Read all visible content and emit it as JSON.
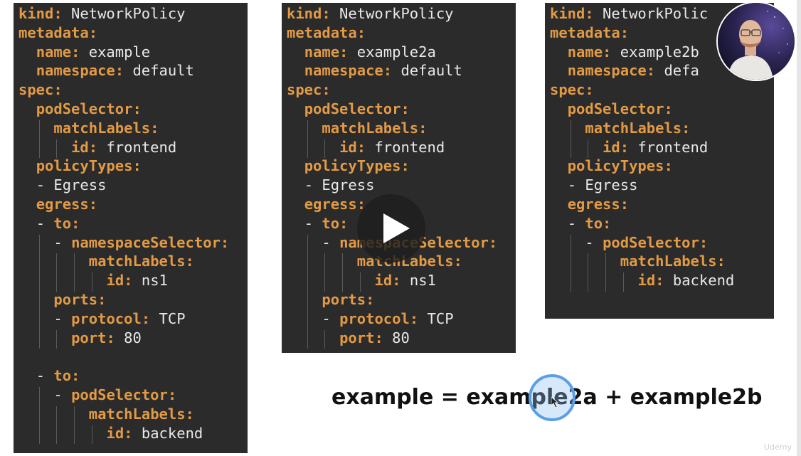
{
  "panels": [
    {
      "id": "panel-1",
      "lines": [
        {
          "indent": 0,
          "key": "kind:",
          "value": " NetworkPolicy"
        },
        {
          "indent": 0,
          "key": "metadata:",
          "value": ""
        },
        {
          "indent": 1,
          "key": "name:",
          "value": " example"
        },
        {
          "indent": 1,
          "key": "namespace:",
          "value": " default"
        },
        {
          "indent": 0,
          "key": "spec:",
          "value": ""
        },
        {
          "indent": 1,
          "key": "podSelector:",
          "value": ""
        },
        {
          "indent": 2,
          "key": "matchLabels:",
          "value": ""
        },
        {
          "indent": 3,
          "key": "id:",
          "value": " frontend"
        },
        {
          "indent": 1,
          "key": "policyTypes:",
          "value": ""
        },
        {
          "indent": 1,
          "key": "",
          "value": "- Egress"
        },
        {
          "indent": 1,
          "key": "egress:",
          "value": ""
        },
        {
          "indent": 1,
          "dash": true,
          "key": "to:",
          "value": ""
        },
        {
          "indent": 2,
          "dash": true,
          "key": "namespaceSelector:",
          "value": ""
        },
        {
          "indent": 4,
          "key": "matchLabels:",
          "value": ""
        },
        {
          "indent": 5,
          "key": "id:",
          "value": " ns1"
        },
        {
          "indent": 2,
          "key": "ports:",
          "value": ""
        },
        {
          "indent": 2,
          "dash": true,
          "key": "protocol:",
          "value": " TCP"
        },
        {
          "indent": 3,
          "key": "port:",
          "value": " 80"
        },
        {
          "indent": 0,
          "key": "",
          "value": ""
        },
        {
          "indent": 1,
          "dash": true,
          "key": "to:",
          "value": ""
        },
        {
          "indent": 2,
          "dash": true,
          "key": "podSelector:",
          "value": ""
        },
        {
          "indent": 4,
          "key": "matchLabels:",
          "value": ""
        },
        {
          "indent": 5,
          "key": "id:",
          "value": " backend"
        }
      ]
    },
    {
      "id": "panel-2",
      "lines": [
        {
          "indent": 0,
          "key": "kind:",
          "value": " NetworkPolicy"
        },
        {
          "indent": 0,
          "key": "metadata:",
          "value": ""
        },
        {
          "indent": 1,
          "key": "name:",
          "value": " example2a"
        },
        {
          "indent": 1,
          "key": "namespace:",
          "value": " default"
        },
        {
          "indent": 0,
          "key": "spec:",
          "value": ""
        },
        {
          "indent": 1,
          "key": "podSelector:",
          "value": ""
        },
        {
          "indent": 2,
          "key": "matchLabels:",
          "value": ""
        },
        {
          "indent": 3,
          "key": "id:",
          "value": " frontend"
        },
        {
          "indent": 1,
          "key": "policyTypes:",
          "value": ""
        },
        {
          "indent": 1,
          "key": "",
          "value": "- Egress"
        },
        {
          "indent": 1,
          "key": "egress:",
          "value": ""
        },
        {
          "indent": 1,
          "dash": true,
          "key": "to:",
          "value": ""
        },
        {
          "indent": 2,
          "dash": true,
          "key": "namespaceSelector:",
          "value": ""
        },
        {
          "indent": 4,
          "key": "matchLabels:",
          "value": ""
        },
        {
          "indent": 5,
          "key": "id:",
          "value": " ns1"
        },
        {
          "indent": 2,
          "key": "ports:",
          "value": ""
        },
        {
          "indent": 2,
          "dash": true,
          "key": "protocol:",
          "value": " TCP"
        },
        {
          "indent": 3,
          "key": "port:",
          "value": " 80"
        }
      ]
    },
    {
      "id": "panel-3",
      "lines": [
        {
          "indent": 0,
          "key": "kind:",
          "value": " NetworkPolic"
        },
        {
          "indent": 0,
          "key": "metadata:",
          "value": ""
        },
        {
          "indent": 1,
          "key": "name:",
          "value": " example2b"
        },
        {
          "indent": 1,
          "key": "namespace:",
          "value": " defa"
        },
        {
          "indent": 0,
          "key": "spec:",
          "value": ""
        },
        {
          "indent": 1,
          "key": "podSelector:",
          "value": ""
        },
        {
          "indent": 2,
          "key": "matchLabels:",
          "value": ""
        },
        {
          "indent": 3,
          "key": "id:",
          "value": " frontend"
        },
        {
          "indent": 1,
          "key": "policyTypes:",
          "value": ""
        },
        {
          "indent": 1,
          "key": "",
          "value": "- Egress"
        },
        {
          "indent": 1,
          "key": "egress:",
          "value": ""
        },
        {
          "indent": 1,
          "dash": true,
          "key": "to:",
          "value": ""
        },
        {
          "indent": 2,
          "dash": true,
          "key": "podSelector:",
          "value": ""
        },
        {
          "indent": 4,
          "key": "matchLabels:",
          "value": ""
        },
        {
          "indent": 5,
          "key": "id:",
          "value": " backend"
        }
      ]
    }
  ],
  "formula": {
    "text": "example = example2a + example2b"
  },
  "player": {
    "play_icon": "play-icon",
    "cursor_icon": "cursor-arrow-icon"
  },
  "webcam": {
    "icon": "presenter-webcam"
  },
  "watermark": {
    "text": "Udemy"
  },
  "colors": {
    "panel_bg": "#2b2b2b",
    "yaml_key": "#e29a45",
    "yaml_value": "#e8e8e8",
    "formula": "#111111",
    "cursor_ring": "#5aa0e6"
  }
}
